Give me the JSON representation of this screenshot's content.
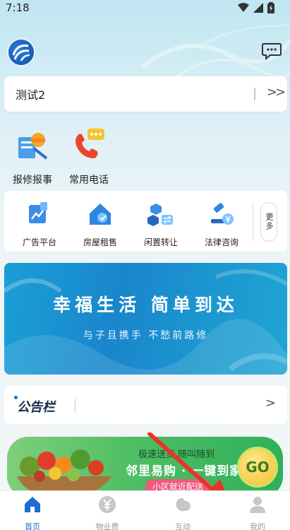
{
  "status_bar": {
    "time": "7:18"
  },
  "colors": {
    "accent": "#1a6fcf",
    "banner": "#1a86cc",
    "promo_green": "#2fb05a",
    "arrow_red": "#e8342a"
  },
  "header": {
    "logo_icon": "community-logo-icon",
    "chat_icon": "message-icon"
  },
  "community": {
    "name": "测试2",
    "arrow": ">>"
  },
  "quick_actions": [
    {
      "label": "报修报事",
      "icon": "repair-icon"
    },
    {
      "label": "常用电话",
      "icon": "phone-icon"
    }
  ],
  "services": {
    "items": [
      {
        "label": "广告平台",
        "icon": "ad-icon"
      },
      {
        "label": "房屋租售",
        "icon": "house-icon"
      },
      {
        "label": "闲置转让",
        "icon": "transfer-icon"
      },
      {
        "label": "法律咨询",
        "icon": "law-icon"
      }
    ],
    "more_label": "更多"
  },
  "banner": {
    "title": "幸福生活 简单到达",
    "subtitle": "与子且携手 不愁前路修"
  },
  "notice": {
    "title": "公告栏",
    "arrow": ">"
  },
  "promo": {
    "line1": "极速送货 随叫随到",
    "line2": "邻里易购 · 一键到家",
    "tag": "小区就近配送",
    "go": "GO"
  },
  "tabbar": [
    {
      "label": "首页",
      "icon": "home-icon",
      "active": true
    },
    {
      "label": "物业费",
      "icon": "yen-icon",
      "active": false
    },
    {
      "label": "互动",
      "icon": "interact-icon",
      "active": false
    },
    {
      "label": "我的",
      "icon": "profile-icon",
      "active": false
    }
  ]
}
